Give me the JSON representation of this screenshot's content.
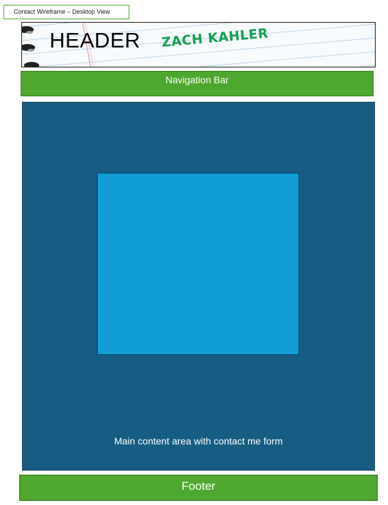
{
  "document": {
    "label": "Contact Wireframe – Desktop View"
  },
  "header": {
    "title": "HEADER",
    "brand": "ZACH KAHLER"
  },
  "nav": {
    "label": "Navigation Bar"
  },
  "main": {
    "label": "Main content area with contact me form"
  },
  "footer": {
    "label": "Footer"
  },
  "colors": {
    "nav_green": "#4ea72e",
    "main_dark_blue": "#175d82",
    "form_light_blue": "#119dd6",
    "brand_green": "#14a050"
  }
}
